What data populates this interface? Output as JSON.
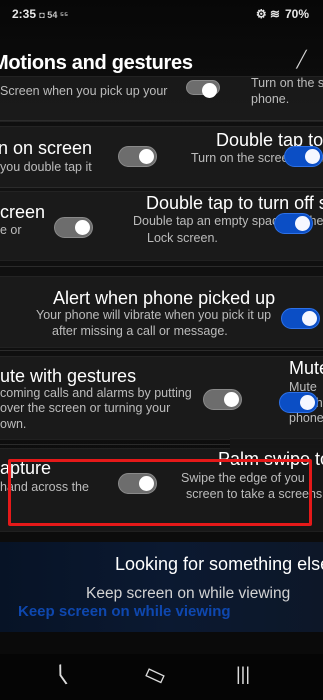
{
  "status_bar": {
    "time": "2:35",
    "small_icons": "◘ 54 ⁵⁵",
    "right_icons": "⚙ ≋",
    "battery": "70%"
  },
  "header": {
    "title": "Motions and gestures",
    "back_icon": "back-arrow-icon"
  },
  "rows": [
    {
      "left_lines": [
        "Screen when you pick up your"
      ],
      "right_lines": [
        "Turn on the screen",
        "phone."
      ]
    },
    {
      "left_lines": [
        "n on screen",
        "you double tap it"
      ],
      "right_lines": [
        "Double tap to tur",
        "Turn on the screen when"
      ]
    },
    {
      "left_lines": [
        "creen",
        "e or"
      ],
      "right_lines": [
        "Double tap to turn off sc",
        "Double tap an empty space on the",
        "Lock screen."
      ]
    },
    {
      "center_lines": [
        "Alert when phone picked up",
        "Your phone will vibrate when you pick it up",
        "after missing a call or message."
      ]
    },
    {
      "left_lines": [
        "ute with gestures",
        "coming calls and alarms by putting",
        "over the screen or turning your",
        "own."
      ],
      "right_lines": [
        "Mute",
        "Mute",
        "your ha",
        "phone face"
      ]
    },
    {
      "left_lines": [
        "apture",
        "hand across the"
      ],
      "right_lines": [
        "Palm swipe to",
        "Swipe the edge of you",
        "screen to take a screens"
      ]
    }
  ],
  "search_panel": {
    "title": "Looking for something else",
    "item": "Keep screen on while viewing",
    "link": "Keep screen on while viewing"
  },
  "nav_bar": {
    "back": "⟨",
    "home": "▭",
    "recents": "|||"
  }
}
